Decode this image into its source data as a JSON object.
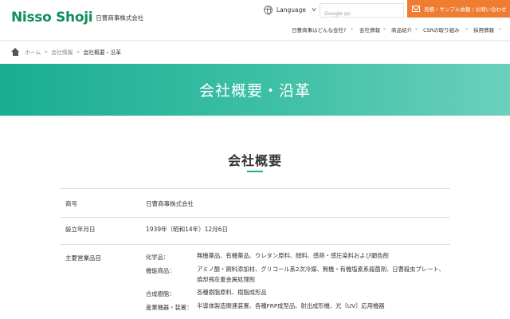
{
  "header": {
    "logo_text": "Nisso Shoji",
    "logo_sub": "日曹商事株式会社",
    "language_label": "Language",
    "search_google": "Google",
    "search_sub": "提供",
    "contact_label": "見積・サンプル依頼 / お問い合わせ",
    "colors": {
      "brand": "#0e8f5a",
      "accent": "#ee7d32",
      "hero": "#3fc0a6"
    }
  },
  "nav": {
    "items": [
      {
        "label": "日曹商事はどんな会社?"
      },
      {
        "label": "会社情報"
      },
      {
        "label": "商品紹介"
      },
      {
        "label": "CSRの取り組み"
      },
      {
        "label": "採用情報"
      }
    ]
  },
  "breadcrumb": {
    "home": "ホーム",
    "parent": "会社情報",
    "current": "会社概要・沿革"
  },
  "hero": {
    "title": "会社概要・沿革"
  },
  "section": {
    "title": "会社概要"
  },
  "company": {
    "rows": [
      {
        "label": "商号",
        "value": "日曹商事株式会社"
      },
      {
        "label": "設立年月日",
        "value": "1939年（昭和14年）12月6日"
      },
      {
        "label": "主要営業品目"
      }
    ],
    "products": [
      {
        "category": "化学品：",
        "value": "無機薬品、有機薬品、ウレタン原料、顔料、感熱・感圧染料および顕色剤"
      },
      {
        "category": "機能商品：",
        "value": "アミノ酸・飼料添加材、グリコール系2次冷媒、無機・有機塩素系殺菌剤、日曹殺虫プレート、焼却飛灰重金属処理剤"
      },
      {
        "category": "合成樹脂：",
        "value": "各種樹脂原料、樹脂成形品"
      },
      {
        "category": "産業機器・装置：",
        "value": "半導体製造関連装置、各種FRP成型品、射出成形機、光〔UV〕応用機器"
      }
    ]
  }
}
